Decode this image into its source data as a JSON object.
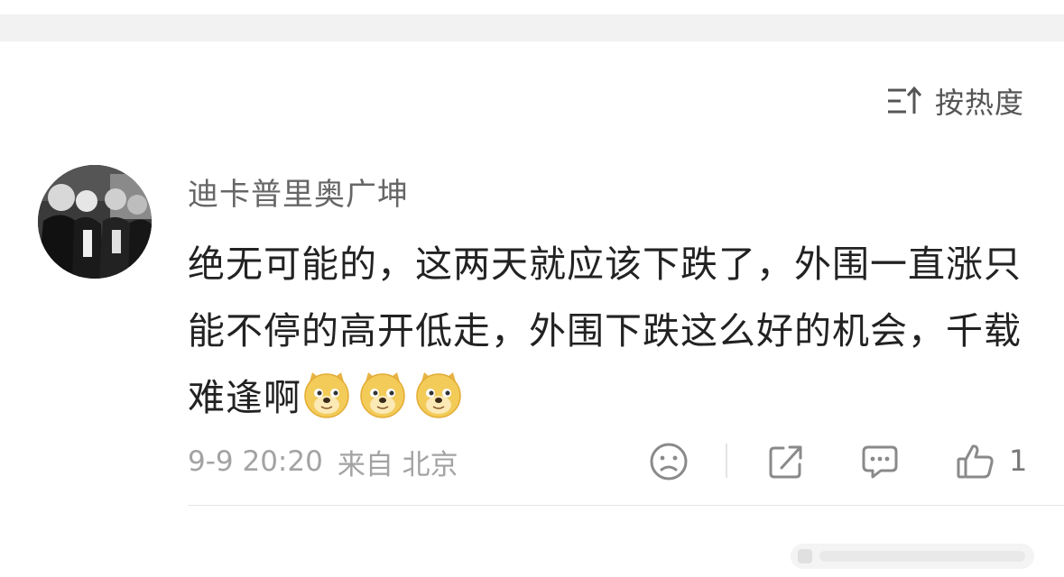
{
  "sort": {
    "icon": "sort-arrows-icon",
    "label": "按热度"
  },
  "comment": {
    "avatar_icon": "user-avatar-photo",
    "username": "迪卡普里奥广坤",
    "text": "绝无可能的，这两天就应该下跌了，外围一直涨只能不停的高开低走，外围下跌这么好的机会，千载难逢啊",
    "emojis": [
      "doge-emoji",
      "doge-emoji",
      "doge-emoji"
    ],
    "date": "9-9 20:20",
    "source": "来自 北京",
    "actions": {
      "dislike_icon": "sad-face-icon",
      "share_icon": "share-icon",
      "reply_icon": "comment-bubble-icon",
      "like_icon": "thumbs-up-icon",
      "like_count": "1"
    }
  },
  "colors": {
    "text": "#222222",
    "muted": "#a3a3a3",
    "username": "#666666",
    "band": "#f2f2f2"
  }
}
